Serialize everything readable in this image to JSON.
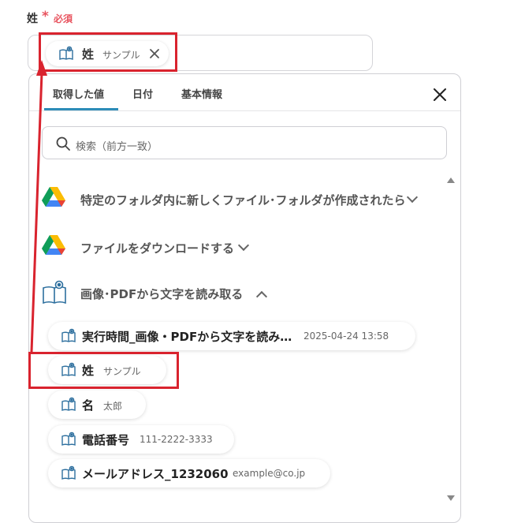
{
  "field": {
    "label": "姓",
    "required_mark": "*",
    "required_text": "必須"
  },
  "selected_chip": {
    "name": "姓",
    "value": "サンプル"
  },
  "tabs": [
    {
      "label": "取得した値"
    },
    {
      "label": "日付"
    },
    {
      "label": "基本情報"
    }
  ],
  "search": {
    "placeholder": "検索（前方一致）"
  },
  "sections": [
    {
      "label": "特定のフォルダ内に新しくファイル･フォルダが作成されたら",
      "icon": "google-drive-icon",
      "expanded": false
    },
    {
      "label": "ファイルをダウンロードする",
      "icon": "google-drive-icon",
      "expanded": false
    },
    {
      "label": "画像･PDFから文字を読み取る",
      "icon": "ocr-book-icon",
      "expanded": true
    }
  ],
  "outputs": [
    {
      "name": "実行時間_画像・PDFから文字を読み…",
      "value": "2025-04-24 13:58"
    },
    {
      "name": "姓",
      "value": "サンプル"
    },
    {
      "name": "名",
      "value": "太郎"
    },
    {
      "name": "電話番号",
      "value": "111-2222-3333"
    },
    {
      "name": "メールアドレス_1232060",
      "value": "example@co.jp"
    }
  ],
  "colors": {
    "required": "#e8545f",
    "tab_active": "#2d8cb8",
    "highlight": "#d9232e"
  }
}
